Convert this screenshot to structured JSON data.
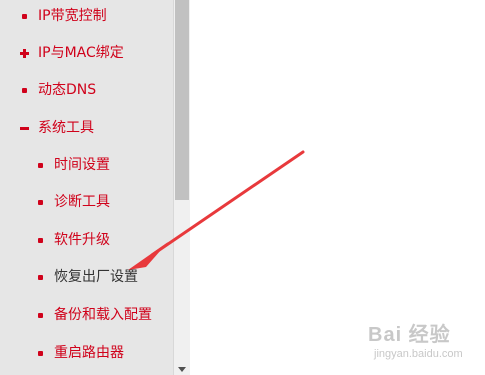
{
  "sidebar": {
    "items": [
      {
        "label": "IP带宽控制",
        "icon": "bullet-icon",
        "level": 1
      },
      {
        "label": "IP与MAC绑定",
        "icon": "plus-icon",
        "level": 1
      },
      {
        "label": "动态DNS",
        "icon": "bullet-icon",
        "level": 1
      },
      {
        "label": "系统工具",
        "icon": "minus-icon",
        "level": 1
      },
      {
        "label": "时间设置",
        "icon": "bullet-icon",
        "level": 2
      },
      {
        "label": "诊断工具",
        "icon": "bullet-icon",
        "level": 2
      },
      {
        "label": "软件升级",
        "icon": "bullet-icon",
        "level": 2
      },
      {
        "label": "恢复出厂设置",
        "icon": "bullet-icon",
        "level": 2,
        "highlighted": true
      },
      {
        "label": "备份和载入配置",
        "icon": "bullet-icon",
        "level": 2
      },
      {
        "label": "重启路由器",
        "icon": "bullet-icon",
        "level": 2
      }
    ]
  },
  "annotation": {
    "color": "#e8393c"
  },
  "watermark": {
    "logo_text": "Bai 经验",
    "sub_text": "jingyan.baidu.com"
  },
  "colors": {
    "menu_text": "#d0021b",
    "highlight_text": "#333333",
    "sidebar_bg": "#e6e6e6"
  }
}
